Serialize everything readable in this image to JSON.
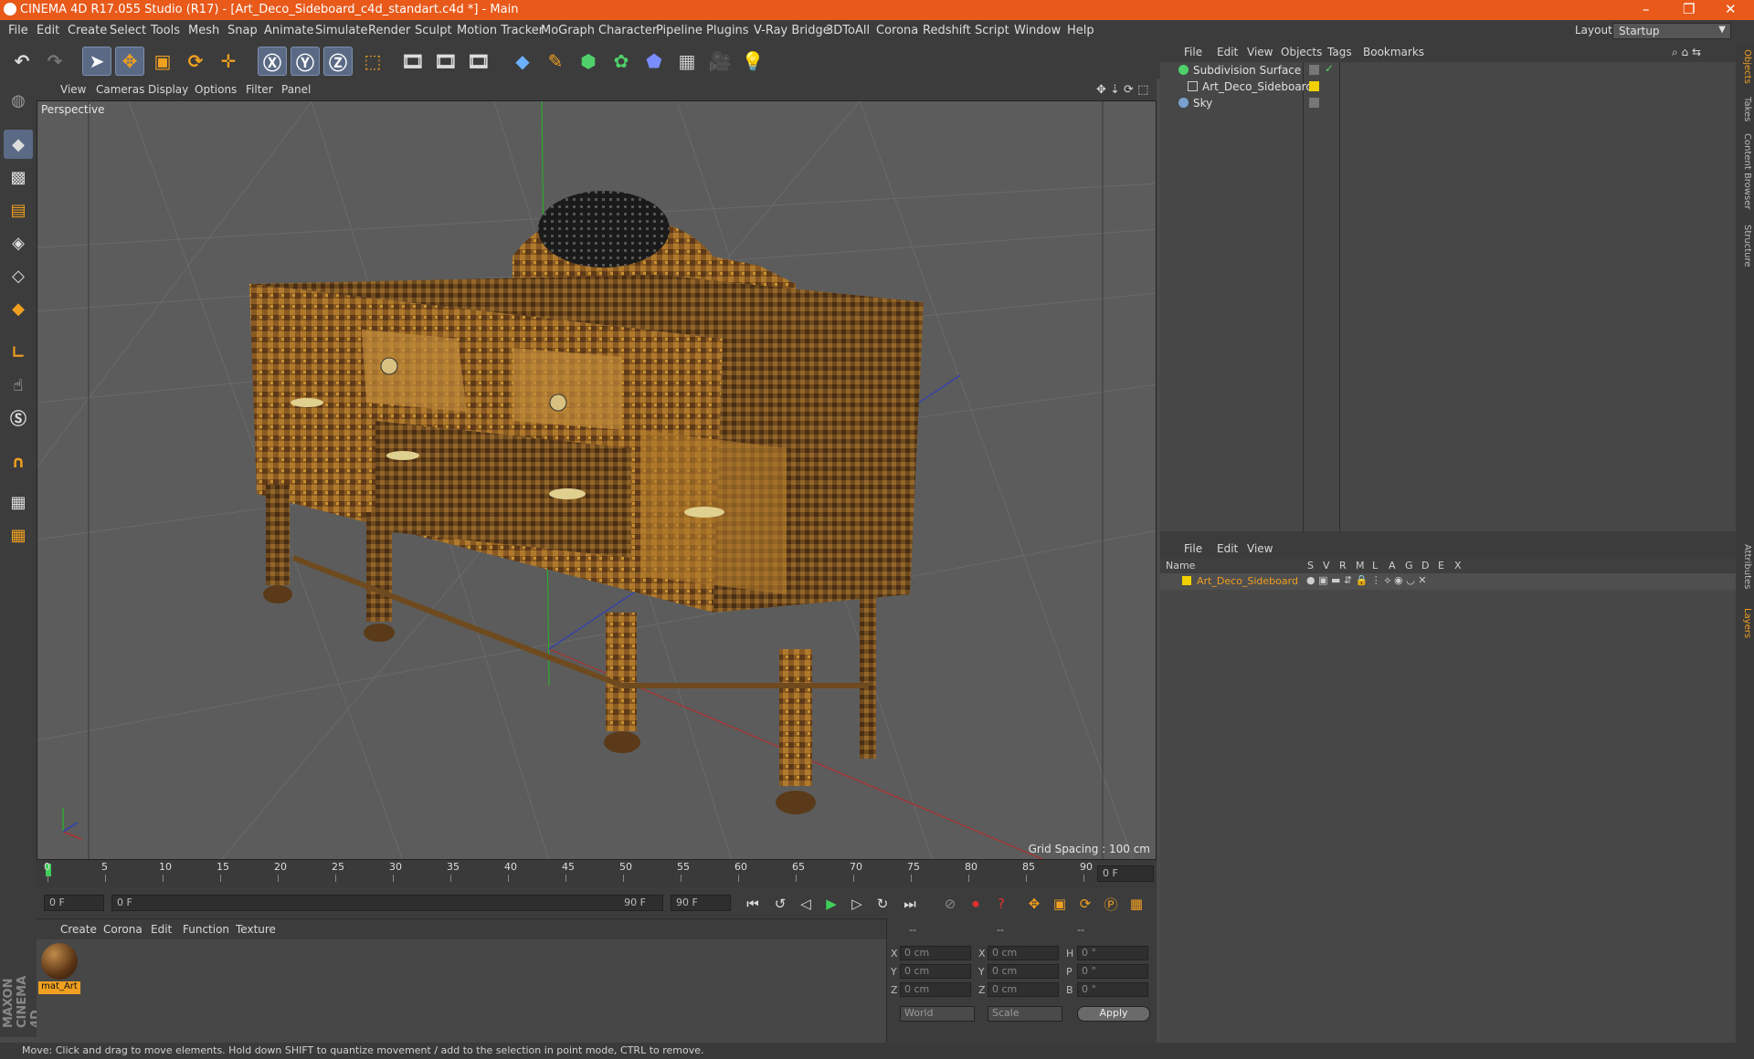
{
  "window": {
    "title": "CINEMA 4D R17.055 Studio (R17) - [Art_Deco_Sideboard_c4d_standart.c4d *] - Main",
    "controls": [
      "–",
      "❐",
      "✕"
    ]
  },
  "menu": [
    "File",
    "Edit",
    "Create",
    "Select",
    "Tools",
    "Mesh",
    "Snap",
    "Animate",
    "Simulate",
    "Render",
    "Sculpt",
    "Motion Tracker",
    "MoGraph",
    "Character",
    "Pipeline",
    "Plugins",
    "V-Ray Bridge",
    "3DToAll",
    "Corona",
    "Redshift",
    "Script",
    "Window",
    "Help"
  ],
  "layout": {
    "label": "Layout:",
    "value": "Startup"
  },
  "viewport": {
    "menu": [
      "View",
      "Cameras",
      "Display",
      "Options",
      "Filter",
      "Panel"
    ],
    "label": "Perspective",
    "grid_spacing": "Grid Spacing : 100 cm"
  },
  "timeline": {
    "ticks": [
      "0",
      "5",
      "10",
      "15",
      "20",
      "25",
      "30",
      "35",
      "40",
      "45",
      "50",
      "55",
      "60",
      "65",
      "70",
      "75",
      "80",
      "85",
      "90"
    ],
    "current": "0 F"
  },
  "transport": {
    "start": "0 F",
    "range_start": "0 F",
    "range_end": "90 F",
    "end": "90 F"
  },
  "material_panel": {
    "menu": [
      "Create",
      "Corona",
      "Edit",
      "Function",
      "Texture"
    ],
    "materials": [
      {
        "name": "mat_Art"
      }
    ]
  },
  "coordinates": {
    "headers": [
      "--",
      "--",
      "--"
    ],
    "rows": [
      {
        "a": "X",
        "av": "0 cm",
        "b": "X",
        "bv": "0 cm",
        "c": "H",
        "cv": "0 °"
      },
      {
        "a": "Y",
        "av": "0 cm",
        "b": "Y",
        "bv": "0 cm",
        "c": "P",
        "cv": "0 °"
      },
      {
        "a": "Z",
        "av": "0 cm",
        "b": "Z",
        "bv": "0 cm",
        "c": "B",
        "cv": "0 °"
      }
    ],
    "world": "World",
    "scale": "Scale",
    "apply": "Apply"
  },
  "status": "Move: Click and drag to move elements. Hold down SHIFT to quantize movement / add to the selection in point mode, CTRL to remove.",
  "objects_panel": {
    "menu": [
      "File",
      "Edit",
      "View",
      "Objects",
      "Tags",
      "Bookmarks"
    ],
    "items": [
      {
        "name": "Subdivision Surface",
        "color": "#9a9a9a"
      },
      {
        "name": "Art_Deco_Sideboard",
        "color": "#f0d000"
      },
      {
        "name": "Sky",
        "color": "#9a9a9a"
      }
    ]
  },
  "layers_panel": {
    "menu": [
      "File",
      "Edit",
      "View"
    ],
    "columns": [
      "Name",
      "S",
      "V",
      "R",
      "M",
      "L",
      "A",
      "G",
      "D",
      "E",
      "X"
    ],
    "items": [
      {
        "name": "Art_Deco_Sideboard",
        "color": "#f0d000"
      }
    ]
  },
  "side_tabs": [
    "Objects",
    "Takes",
    "Content Browser",
    "Structure",
    "Attributes",
    "Layers"
  ],
  "brand": "MAXON CINEMA 4D",
  "accent": "#e8591a"
}
